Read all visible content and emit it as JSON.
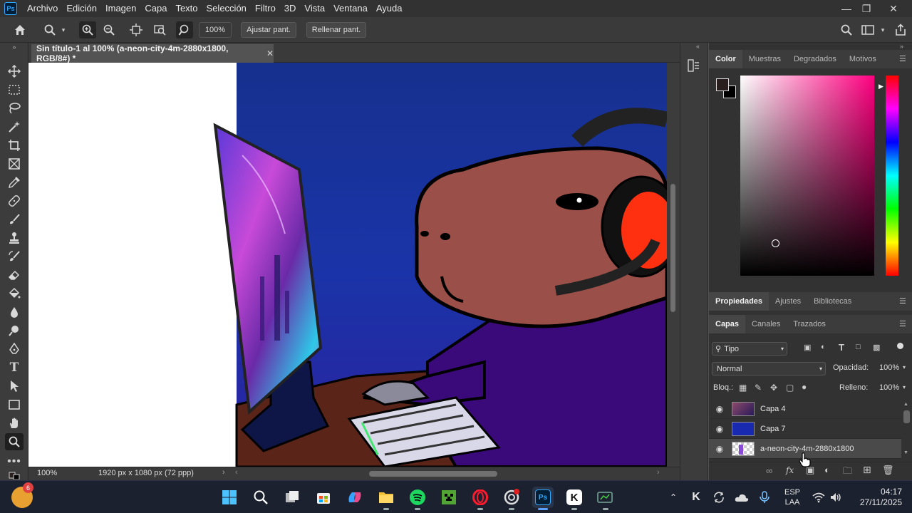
{
  "app": {
    "menu": [
      "Archivo",
      "Edición",
      "Imagen",
      "Capa",
      "Texto",
      "Selección",
      "Filtro",
      "3D",
      "Vista",
      "Ventana",
      "Ayuda"
    ],
    "logo_text": "Ps"
  },
  "options_bar": {
    "zoom_value": "100%",
    "fit_screen_label": "Ajustar pant.",
    "fill_screen_label": "Rellenar pant."
  },
  "document": {
    "tab_title": "Sin título-1 al 100% (a-neon-city-4m-2880x1800, RGB/8#) *",
    "zoom": "100%",
    "dimensions": "1920 px x 1080 px (72 ppp)"
  },
  "color_panel": {
    "tabs": [
      "Color",
      "Muestras",
      "Degradados",
      "Motivos"
    ],
    "foreground": "#2a1f1f",
    "background": "#000000",
    "hue": "#ff0080"
  },
  "properties_panel": {
    "tabs": [
      "Propiedades",
      "Ajustes",
      "Bibliotecas"
    ]
  },
  "layers_panel": {
    "tabs": [
      "Capas",
      "Canales",
      "Trazados"
    ],
    "filter_kind": "Tipo",
    "blend_mode": "Normal",
    "opacity_label": "Opacidad:",
    "opacity_value": "100%",
    "lock_label": "Bloq.:",
    "fill_label": "Relleno:",
    "fill_value": "100%",
    "layers": [
      {
        "name": "Capa 4",
        "selected": false
      },
      {
        "name": "Capa 7",
        "selected": false
      },
      {
        "name": "a-neon-city-4m-2880x1800",
        "selected": true
      }
    ],
    "footer_fx": "fx"
  },
  "taskbar": {
    "language_line1": "ESP",
    "language_line2": "LAA",
    "time": "04:17",
    "date": "27/11/2025",
    "notification_count": "6"
  }
}
